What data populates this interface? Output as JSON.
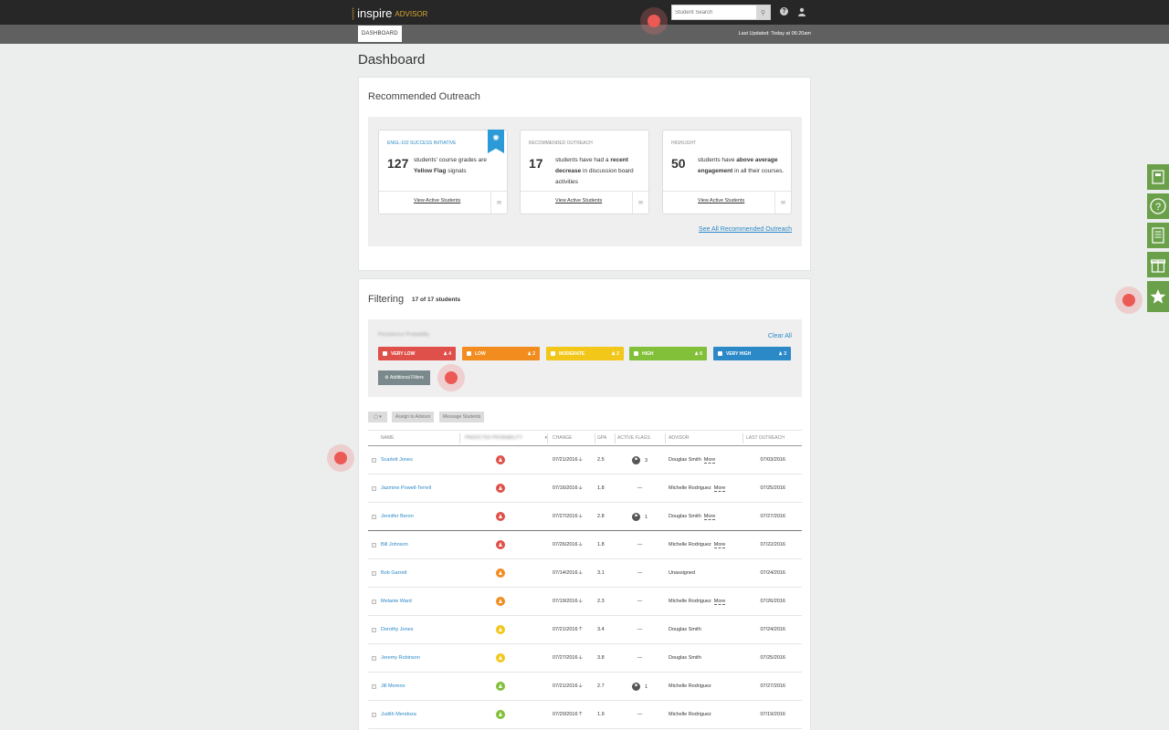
{
  "brand": {
    "name": "inspire",
    "product": "ADVISOR"
  },
  "search": {
    "placeholder": "Student Search"
  },
  "nav": {
    "tab": "DASHBOARD",
    "last_updated": "Last Updated: Today at 06:20am"
  },
  "page": {
    "title": "Dashboard"
  },
  "outreach": {
    "title": "Recommended Outreach",
    "cards": [
      {
        "tag": "ENGL-102 SUCCESS INITIATIVE",
        "number": "127",
        "text_a": "students' course grades are ",
        "text_b": "Yellow Flag",
        "text_c": " signals",
        "link": "View Active Students"
      },
      {
        "tag": "RECOMMENDED OUTREACH",
        "number": "17",
        "text_a": "students have had a ",
        "text_b": "recent decrease",
        "text_c": " in discussion board activities",
        "link": "View Active Students"
      },
      {
        "tag": "HIGHLIGHT",
        "number": "50",
        "text_a": "students have ",
        "text_b": "above average engagement",
        "text_c": " in all their courses.",
        "link": "View Active Students"
      }
    ],
    "see_all": "See All Recommended Outreach"
  },
  "filtering": {
    "title": "Filtering",
    "count": "17 of 17 students",
    "persistence_label": "Persistence Probability",
    "clear_all": "Clear All",
    "pills": [
      {
        "label": "VERY LOW",
        "count": "4",
        "color": "#e0504a"
      },
      {
        "label": "LOW",
        "count": "2",
        "color": "#f28c1e"
      },
      {
        "label": "MODERATE",
        "count": "2",
        "color": "#f2c71a"
      },
      {
        "label": "HIGH",
        "count": "6",
        "color": "#82c03a"
      },
      {
        "label": "VERY HIGH",
        "count": "3",
        "color": "#2b89c8"
      }
    ],
    "additional_filters": "Additional Filters"
  },
  "toolbar": {
    "assign": "Assign to Advisor",
    "message": "Message Students"
  },
  "table": {
    "headers": [
      "NAME",
      "PREDICTED PROBABILITY",
      "CHANGE",
      "GPA",
      "ACTIVE FLAGS",
      "ADVISOR",
      "LAST OUTREACH"
    ],
    "rows": [
      {
        "name": "Scarlett Jones",
        "risk": "#e0504a",
        "change": "07/21/2016",
        "dir": "down",
        "gpa": "2.5",
        "flags": "3",
        "advisor": "Douglas Smith",
        "more": "More",
        "last": "07/03/2016"
      },
      {
        "name": "Jazmine Powell-Terrell",
        "risk": "#e0504a",
        "change": "07/16/2016",
        "dir": "down",
        "gpa": "1.8",
        "flags": "—",
        "advisor": "Michelle Rodriguez",
        "more": "More",
        "last": "07/25/2016"
      },
      {
        "name": "Jennifer Beron",
        "risk": "#e0504a",
        "change": "07/27/2016",
        "dir": "down",
        "gpa": "2.8",
        "flags": "1",
        "advisor": "Douglas Smith",
        "more": "More",
        "last": "07/27/2016"
      },
      {
        "name": "Bill Johnson",
        "risk": "#e0504a",
        "change": "07/26/2016",
        "dir": "down",
        "gpa": "1.8",
        "flags": "—",
        "advisor": "Michelle Rodriguez",
        "more": "More",
        "last": "07/22/2016"
      },
      {
        "name": "Bob Garrett",
        "risk": "#f28c1e",
        "change": "07/14/2016",
        "dir": "down",
        "gpa": "3.1",
        "flags": "—",
        "advisor": "Unassigned",
        "more": "",
        "last": "07/24/2016"
      },
      {
        "name": "Melanie Ward",
        "risk": "#f28c1e",
        "change": "07/19/2016",
        "dir": "down",
        "gpa": "2.3",
        "flags": "—",
        "advisor": "Michelle Rodriguez",
        "more": "More",
        "last": "07/26/2016"
      },
      {
        "name": "Dorothy Jones",
        "risk": "#f2c71a",
        "change": "07/21/2016",
        "dir": "up",
        "gpa": "3.4",
        "flags": "—",
        "advisor": "Douglas Smith",
        "more": "",
        "last": "07/24/2016"
      },
      {
        "name": "Jeremy Robinson",
        "risk": "#f2c71a",
        "change": "07/27/2016",
        "dir": "down",
        "gpa": "3.8",
        "flags": "—",
        "advisor": "Douglas Smith",
        "more": "",
        "last": "07/25/2016"
      },
      {
        "name": "Jill Moreno",
        "risk": "#82c03a",
        "change": "07/21/2016",
        "dir": "down",
        "gpa": "2.7",
        "flags": "1",
        "advisor": "Michelle Rodriguez",
        "more": "",
        "last": "07/27/2016"
      },
      {
        "name": "Judith Mendoza",
        "risk": "#82c03a",
        "change": "07/20/2016",
        "dir": "up",
        "gpa": "1.9",
        "flags": "—",
        "advisor": "Michelle Rodriguez",
        "more": "",
        "last": "07/19/2016"
      }
    ]
  },
  "side_rail": [
    "grid-icon",
    "help-circle-icon",
    "receipt-icon",
    "gift-icon",
    "star-icon"
  ]
}
